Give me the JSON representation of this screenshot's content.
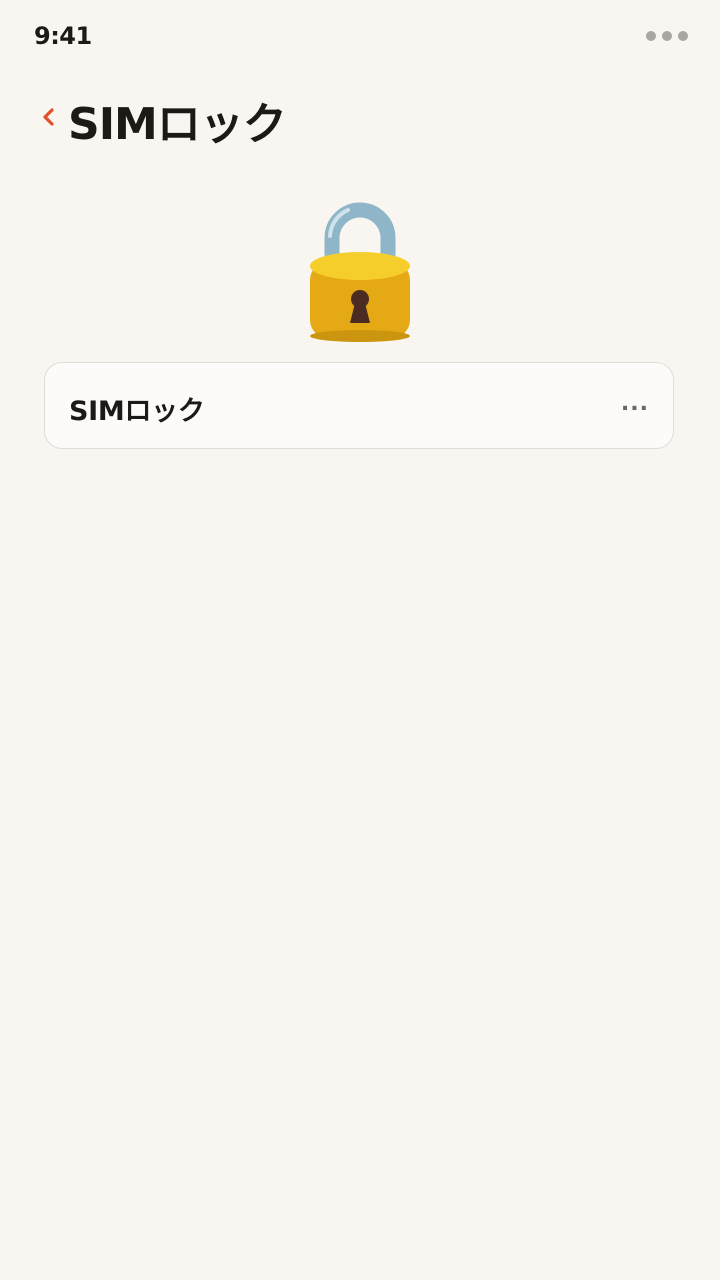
{
  "status_bar": {
    "time": "9:41",
    "menu_icon": "more-dots-icon"
  },
  "header": {
    "back_icon": "chevron-left-icon",
    "title": "SIMロック"
  },
  "hero": {
    "icon": "padlock-icon"
  },
  "card": {
    "label": "SIMロック",
    "more": "..."
  },
  "colors": {
    "background": "#f9f6f2",
    "accent": "#e2502a",
    "text": "#1c1a17"
  }
}
